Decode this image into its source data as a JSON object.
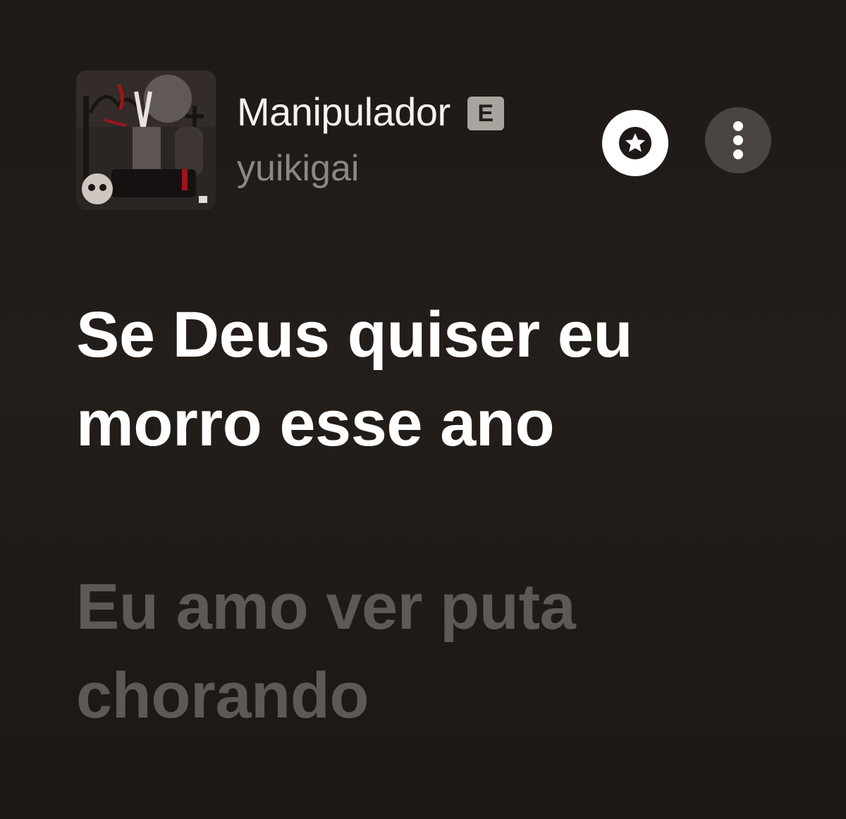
{
  "now_playing": {
    "title": "Manipulador",
    "explicit_badge": "E",
    "artist": "yuikigai",
    "artwork_icon": "album-artwork"
  },
  "actions": {
    "favorite_icon": "star-icon",
    "more_icon": "more-vertical-icon"
  },
  "lyrics": {
    "current_line": "Se Deus quiser eu morro esse ano",
    "next_line": "Eu amo ver puta chorando"
  },
  "colors": {
    "background": "#221c19",
    "current_lyric": "#ffffff",
    "upcoming_lyric": "#5f5956",
    "artist_text": "#8d8783"
  }
}
